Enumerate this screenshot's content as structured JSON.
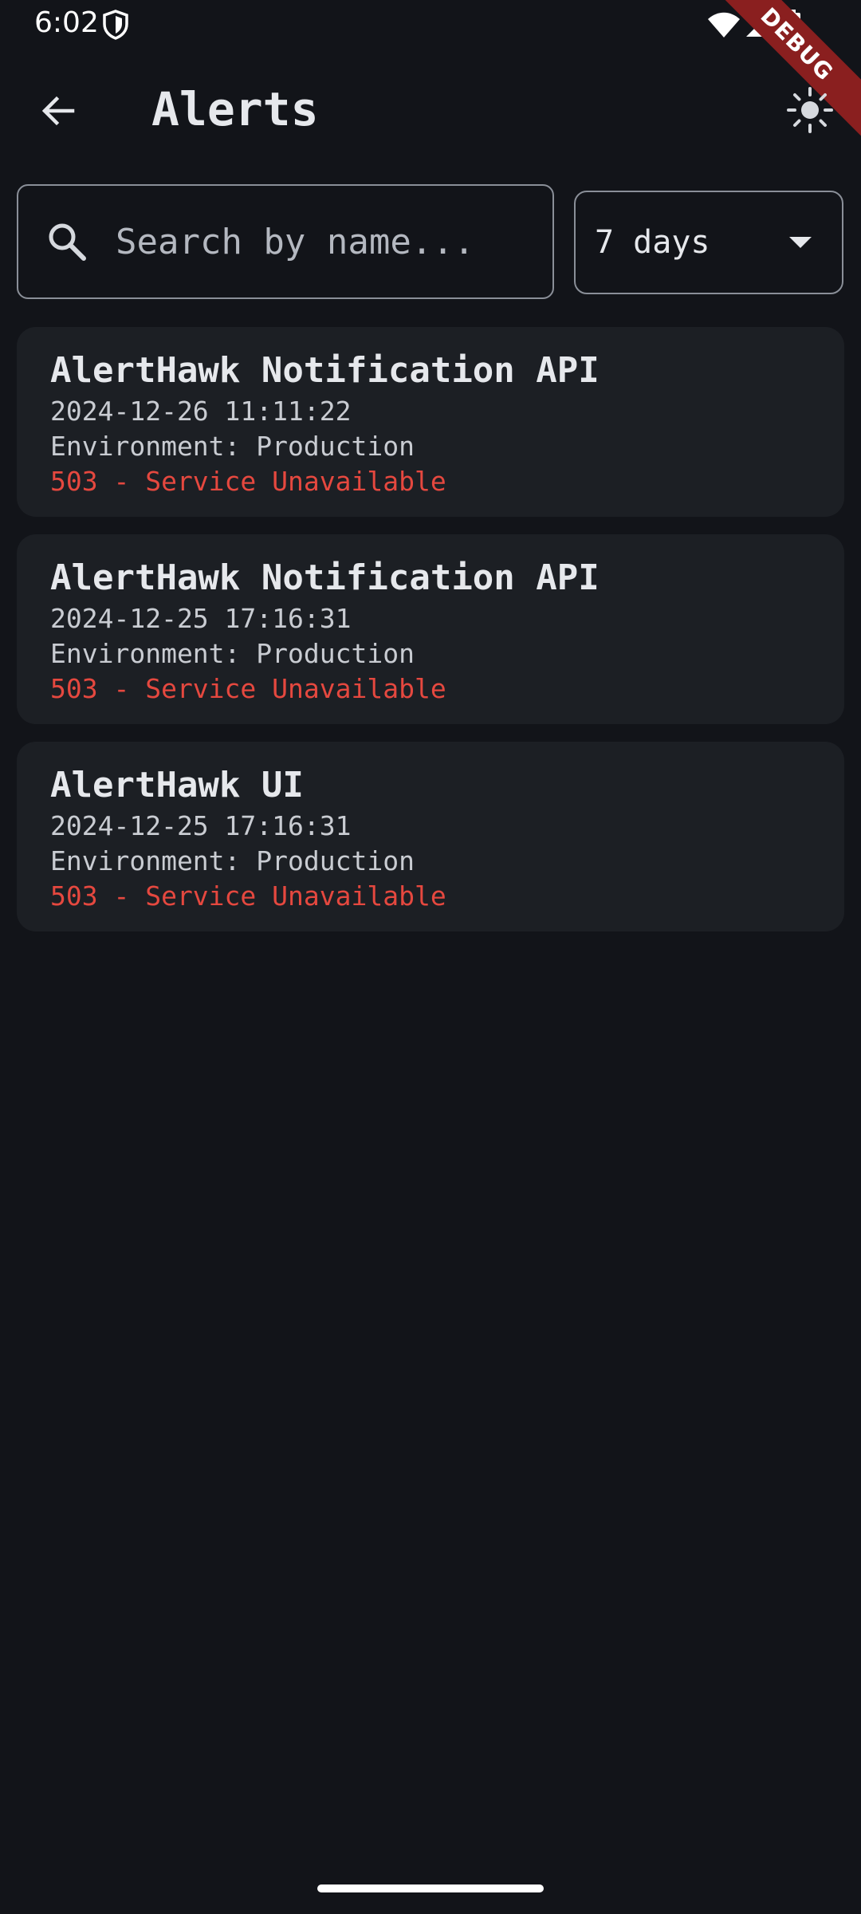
{
  "status_bar": {
    "time": "6:02"
  },
  "debug_banner": {
    "label": "DEBUG"
  },
  "app_bar": {
    "title": "Alerts",
    "back_icon": "arrow-back-icon",
    "theme_icon": "sun-icon"
  },
  "search": {
    "placeholder": "Search by name...",
    "value": "",
    "icon": "search-icon"
  },
  "filter": {
    "selected": "7 days",
    "icon": "chevron-down-icon"
  },
  "alerts": [
    {
      "name": "AlertHawk Notification API",
      "timestamp": "2024-12-26 11:11:22",
      "environment": "Environment: Production",
      "status": "503 - Service Unavailable"
    },
    {
      "name": "AlertHawk Notification API",
      "timestamp": "2024-12-25 17:16:31",
      "environment": "Environment: Production",
      "status": "503 - Service Unavailable"
    },
    {
      "name": "AlertHawk UI",
      "timestamp": "2024-12-25 17:16:31",
      "environment": "Environment: Production",
      "status": "503 - Service Unavailable"
    }
  ],
  "colors": {
    "background": "#121419",
    "card": "#1c1f24",
    "error": "#e5483f",
    "debug_banner": "#8a1f1f"
  }
}
